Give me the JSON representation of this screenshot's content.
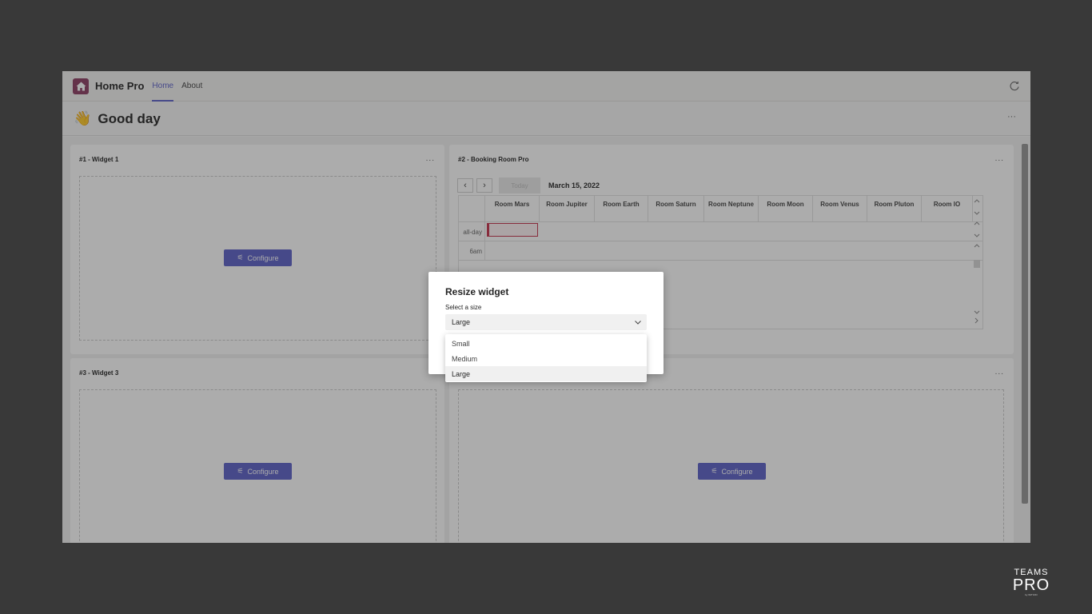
{
  "app": {
    "name": "Home Pro",
    "tabs": [
      {
        "label": "Home",
        "active": true
      },
      {
        "label": "About",
        "active": false
      }
    ],
    "accent": "#5b5fc7",
    "brand_color": "#8b3a62"
  },
  "greeting": {
    "text": "Good day",
    "more": "···"
  },
  "widgets": [
    {
      "title": "#1 - Widget 1",
      "more": "...",
      "configure_label": "Configure"
    },
    {
      "title": "#2 - Booking Room Pro",
      "more": "..."
    },
    {
      "title": "#3 - Widget 3",
      "configure_label": "Configure"
    },
    {
      "more": "...",
      "configure_label": "Configure"
    }
  ],
  "calendar": {
    "today_label": "Today",
    "date": "March 15, 2022",
    "rooms": [
      "Room Mars",
      "Room Jupiter",
      "Room Earth",
      "Room Saturn",
      "Room Neptune",
      "Room Moon",
      "Room Venus",
      "Room Pluton",
      "Room IO"
    ],
    "rows": [
      "all-day",
      "6am"
    ]
  },
  "dialog": {
    "title": "Resize widget",
    "label": "Select a size",
    "selected": "Large",
    "options": [
      "Small",
      "Medium",
      "Large"
    ]
  },
  "branding": {
    "line1": "TEAMS",
    "line2": "PRO",
    "line3": "by WITIVIO"
  }
}
